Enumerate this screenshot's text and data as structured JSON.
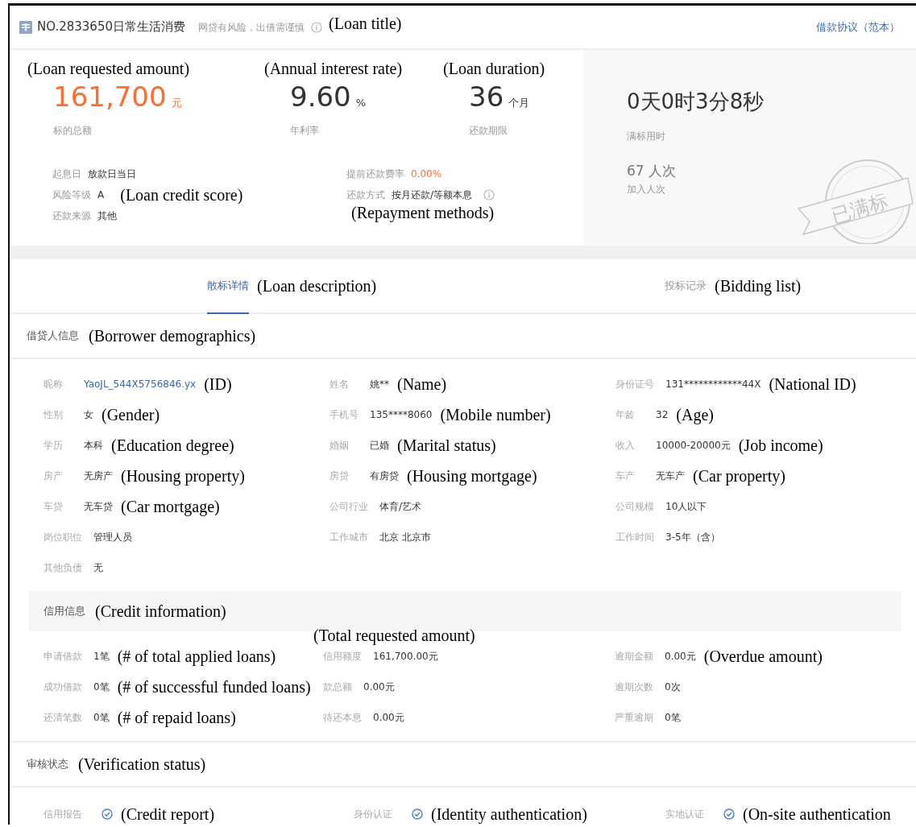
{
  "header": {
    "title": "NO.2833650日常生活消费",
    "risk_note": "网贷有风险，出借需谨慎",
    "annotation": "(Loan title)",
    "agreement_link": "借款协议（范本）"
  },
  "stats": [
    {
      "annotation": "(Loan requested amount)",
      "value": "161,700",
      "unit": "元",
      "label": "标的总额",
      "kind": "highlight"
    },
    {
      "annotation": "(Annual interest rate)",
      "value": "9.60",
      "unit": "%",
      "label": "年利率",
      "kind": "plain"
    },
    {
      "annotation": "(Loan duration)",
      "value": "36",
      "unit": "个月",
      "label": "还款期限",
      "kind": "plain"
    }
  ],
  "details_left": [
    {
      "label": "起息日",
      "value": "放款日当日"
    },
    {
      "label": "风险等级",
      "value": "A",
      "annotation": "(Loan credit score)"
    },
    {
      "label": "还款来源",
      "value": "其他"
    }
  ],
  "details_right": [
    {
      "label": "提前还款费率",
      "value": "0.00%",
      "kind": "highlight"
    },
    {
      "label": "还款方式",
      "value": "按月还款/等额本息",
      "kind": "plain",
      "info": true,
      "annotation": "(Repayment methods)",
      "annotation_below": true
    }
  ],
  "summary": {
    "duration": "0天0时3分8秒",
    "duration_label": "满标用时",
    "count": "67 人次",
    "count_label": "加入人次",
    "stamp": "已满标"
  },
  "tabs": [
    {
      "label": "散标详情",
      "selected": true,
      "annotation": "(Loan description)"
    },
    {
      "label": "投标记录",
      "selected": false,
      "annotation": "(Bidding list)"
    }
  ],
  "borrower": {
    "title": "借贷人信息",
    "annotation": "(Borrower demographics)",
    "fields": [
      {
        "label": "昵称",
        "value": "YaoJL_544X5756846.yx",
        "kind": "link",
        "annotation": "(ID)"
      },
      {
        "label": "姓名",
        "value": "姚**",
        "annotation": "(Name)"
      },
      {
        "label": "身份证号",
        "value": "131************44X",
        "annotation": "(National ID)"
      },
      {
        "label": "性别",
        "value": "女",
        "annotation": "(Gender)"
      },
      {
        "label": "手机号",
        "value": "135****8060",
        "annotation": "(Mobile number)"
      },
      {
        "label": "年龄",
        "value": "32",
        "annotation": "(Age)"
      },
      {
        "label": "学历",
        "value": "本科",
        "annotation": "(Education degree)"
      },
      {
        "label": "婚姻",
        "value": "已婚",
        "annotation": "(Marital status)"
      },
      {
        "label": "收入",
        "value": "10000-20000元",
        "annotation": "(Job income)"
      },
      {
        "label": "房产",
        "value": "无房产",
        "annotation": "(Housing property)"
      },
      {
        "label": "房贷",
        "value": "有房贷",
        "annotation": "(Housing mortgage)"
      },
      {
        "label": "车产",
        "value": "无车产",
        "annotation": "(Car property)"
      },
      {
        "label": "车贷",
        "value": "无车贷",
        "annotation": "(Car mortgage)"
      },
      {
        "label": "公司行业",
        "value": "体育/艺术"
      },
      {
        "label": "公司规模",
        "value": "10人以下"
      },
      {
        "label": "岗位职位",
        "value": "管理人员"
      },
      {
        "label": "工作城市",
        "value": "北京 北京市"
      },
      {
        "label": "工作时间",
        "value": "3-5年（含）"
      },
      {
        "label": "其他负债",
        "value": "无"
      }
    ]
  },
  "credit": {
    "title": "信用信息",
    "annotation": "(Credit information)",
    "fields": [
      {
        "label": "申请借款",
        "value": "1笔",
        "annotation": "(# of total applied loans)"
      },
      {
        "label": "信用额度",
        "value": "161,700.00元",
        "annotation": "(Total requested amount)",
        "annotation_above": true
      },
      {
        "label": "逾期金额",
        "value": "0.00元",
        "annotation": "(Overdue amount)"
      },
      {
        "label": "成功借款",
        "value": "0笔",
        "annotation": "(# of successful funded loans)"
      },
      {
        "label": "款总额",
        "value": "0.00元"
      },
      {
        "label": "逾期次数",
        "value": "0次"
      },
      {
        "label": "还清笔数",
        "value": "0笔",
        "annotation": "(# of repaid loans)"
      },
      {
        "label": "待还本息",
        "value": "0.00元"
      },
      {
        "label": "严重逾期",
        "value": "0笔"
      }
    ]
  },
  "verification": {
    "title": "审核状态",
    "annotation": "(Verification status)",
    "items": [
      {
        "label": "信用报告",
        "verified": true,
        "annotation": "(Credit report)"
      },
      {
        "label": "身份认证",
        "verified": true,
        "annotation": "(Identity authentication)"
      },
      {
        "label": "实地认证",
        "verified": true,
        "annotation": "(On-site authentication"
      }
    ]
  }
}
